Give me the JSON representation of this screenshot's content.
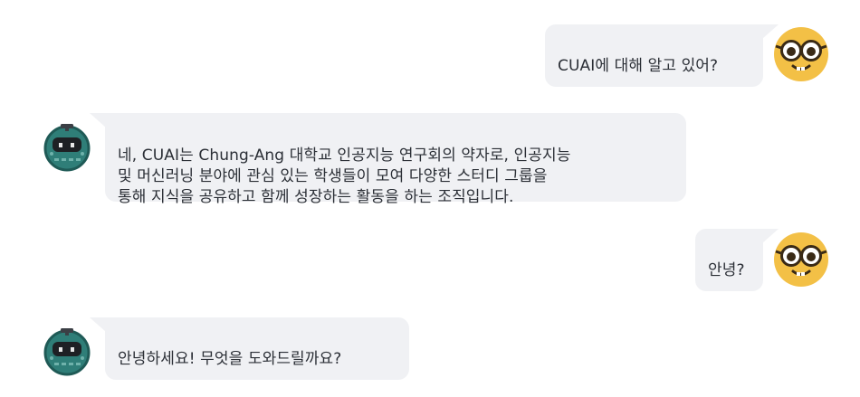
{
  "messages": [
    {
      "role": "user",
      "text": "CUAI에 대해 알고 있어?",
      "avatar_icon": "nerd-face-icon"
    },
    {
      "role": "assistant",
      "text": "네, CUAI는 Chung-Ang 대학교 인공지능 연구회의 약자로, 인공지능\n및 머신러닝 분야에 관심 있는 학생들이 모여 다양한 스터디 그룹을\n통해 지식을 공유하고 함께 성장하는 활동을 하는 조직입니다.",
      "avatar_icon": "robot-icon"
    },
    {
      "role": "user",
      "text": "안녕?",
      "avatar_icon": "nerd-face-icon"
    },
    {
      "role": "assistant",
      "text": "안녕하세요! 무엇을 도와드릴까요?",
      "avatar_icon": "robot-icon"
    }
  ],
  "colors": {
    "bubble": "#f0f1f4",
    "text": "#2b2f36",
    "user_avatar": "#f3c046",
    "bot_avatar": "#2f7e78"
  }
}
